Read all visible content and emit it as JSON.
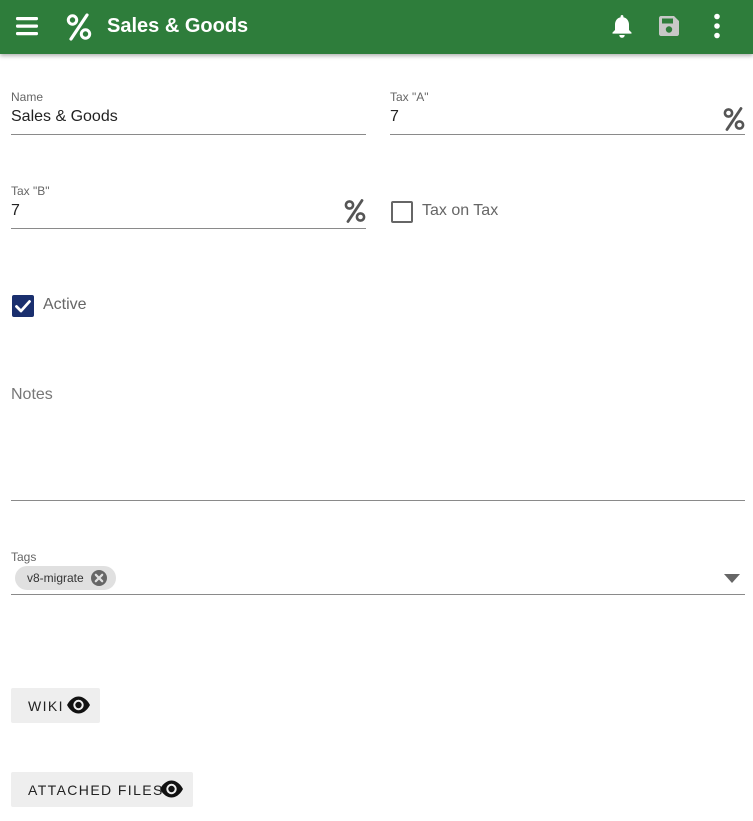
{
  "header": {
    "title": "Sales & Goods",
    "bg_color": "#2e7d3b",
    "icons": [
      "menu-icon",
      "percent-icon",
      "bell-icon",
      "save-icon",
      "more-vert-icon"
    ]
  },
  "form": {
    "name": {
      "label": "Name",
      "value": "Sales & Goods"
    },
    "tax_a": {
      "label": "Tax \"A\"",
      "value": "7",
      "suffix_icon": "percent-icon"
    },
    "tax_b": {
      "label": "Tax \"B\"",
      "value": "7",
      "suffix_icon": "percent-icon"
    },
    "tax_on_tax": {
      "label": "Tax on Tax",
      "checked": false
    },
    "active": {
      "label": "Active",
      "checked": true,
      "color": "#1a2f6e"
    },
    "notes": {
      "placeholder": "Notes",
      "value": ""
    },
    "tags": {
      "label": "Tags",
      "chips": [
        "v8-migrate"
      ]
    }
  },
  "buttons": {
    "wiki": {
      "label": "WIKI",
      "icon": "eye-icon"
    },
    "attached_files": {
      "label": "ATTACHED FILES",
      "icon": "eye-icon"
    }
  }
}
